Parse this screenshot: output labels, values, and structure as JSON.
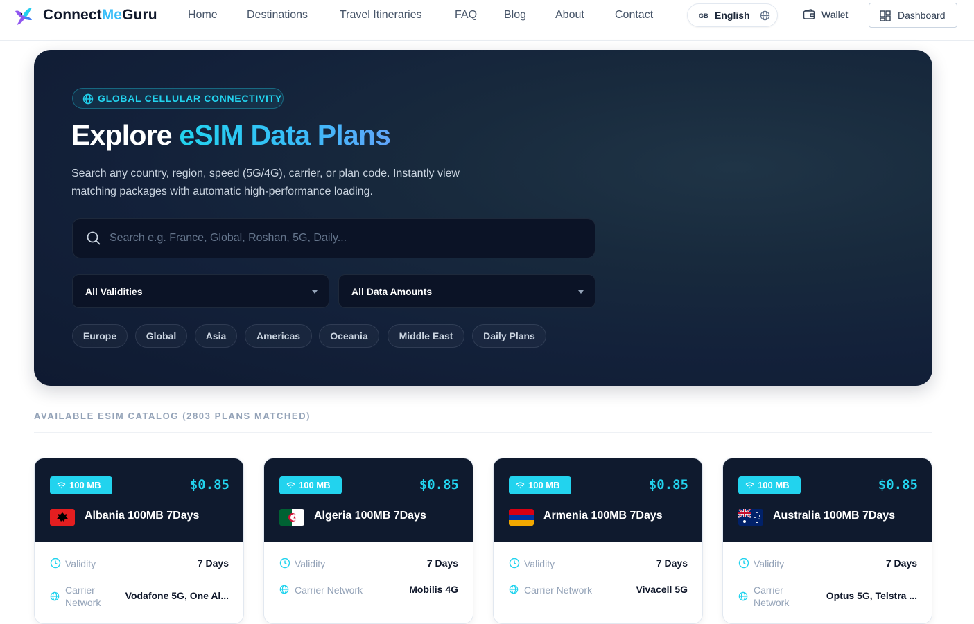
{
  "header": {
    "brand_prefix": "Connect",
    "brand_accent": "Me",
    "brand_suffix": "Guru",
    "nav": [
      "Home",
      "Destinations",
      "Travel Itineraries",
      "FAQ",
      "Blog",
      "About",
      "Contact"
    ],
    "language_code": "GB",
    "language": "English",
    "wallet": "Wallet",
    "dashboard": "Dashboard"
  },
  "hero": {
    "badge": "GLOBAL CELLULAR CONNECTIVITY",
    "title_plain": "Explore",
    "title_accent": "eSIM Data Plans",
    "description": "Search any country, region, speed (5G/4G), carrier, or plan code. Instantly view matching packages with automatic high-performance loading.",
    "search_placeholder": "Search e.g. France, Global, Roshan, 5G, Daily...",
    "validity_select": "All Validities",
    "data_select": "All Data Amounts",
    "chips": [
      "Europe",
      "Global",
      "Asia",
      "Americas",
      "Oceania",
      "Middle East",
      "Daily Plans"
    ]
  },
  "catalog": {
    "title": "AVAILABLE ESIM CATALOG (2803 PLANS MATCHED)",
    "validity_label": "Validity",
    "carrier_label": "Carrier Network",
    "cards": [
      {
        "data": "100 MB",
        "price": "$0.85",
        "name": "Albania 100MB 7Days",
        "validity": "7 Days",
        "carrier": "Vodafone 5G, One Al...",
        "flag": "albania"
      },
      {
        "data": "100 MB",
        "price": "$0.85",
        "name": "Algeria 100MB 7Days",
        "validity": "7 Days",
        "carrier": "Mobilis 4G",
        "flag": "algeria"
      },
      {
        "data": "100 MB",
        "price": "$0.85",
        "name": "Armenia 100MB 7Days",
        "validity": "7 Days",
        "carrier": "Vivacell 5G",
        "flag": "armenia"
      },
      {
        "data": "100 MB",
        "price": "$0.85",
        "name": "Australia 100MB 7Days",
        "validity": "7 Days",
        "carrier": "Optus 5G, Telstra ...",
        "flag": "australia"
      }
    ]
  },
  "colors": {
    "accent": "#22d3ee",
    "hero_bg": "#13213a",
    "card_header": "#0f1a2e"
  }
}
